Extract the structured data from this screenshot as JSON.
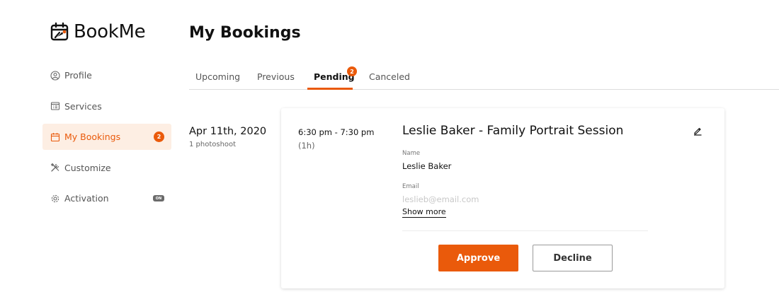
{
  "app": {
    "name": "BookMe",
    "accent_color": "#ea5a0b"
  },
  "sidebar": {
    "items": [
      {
        "label": "Profile",
        "icon": "user-circle-icon"
      },
      {
        "label": "Services",
        "icon": "list-card-icon"
      },
      {
        "label": "My Bookings",
        "icon": "calendar-icon",
        "badge": "2",
        "active": true
      },
      {
        "label": "Customize",
        "icon": "tools-icon"
      },
      {
        "label": "Activation",
        "icon": "gear-icon",
        "toggle_label": "ON"
      }
    ]
  },
  "page": {
    "title": "My Bookings"
  },
  "tabs": [
    {
      "label": "Upcoming"
    },
    {
      "label": "Previous"
    },
    {
      "label": "Pending",
      "badge": "2",
      "active": true
    },
    {
      "label": "Canceled"
    }
  ],
  "booking": {
    "date": "Apr 11th, 2020",
    "date_sub": "1 photoshoot",
    "time": "6:30 pm - 7:30 pm",
    "duration": "(1h)",
    "title": "Leslie Baker - Family Portrait Session",
    "name_label": "Name",
    "name_value": "Leslie Baker",
    "email_label": "Email",
    "email_value": "leslieb@email.com",
    "show_more": "Show more",
    "approve_label": "Approve",
    "decline_label": "Decline"
  }
}
